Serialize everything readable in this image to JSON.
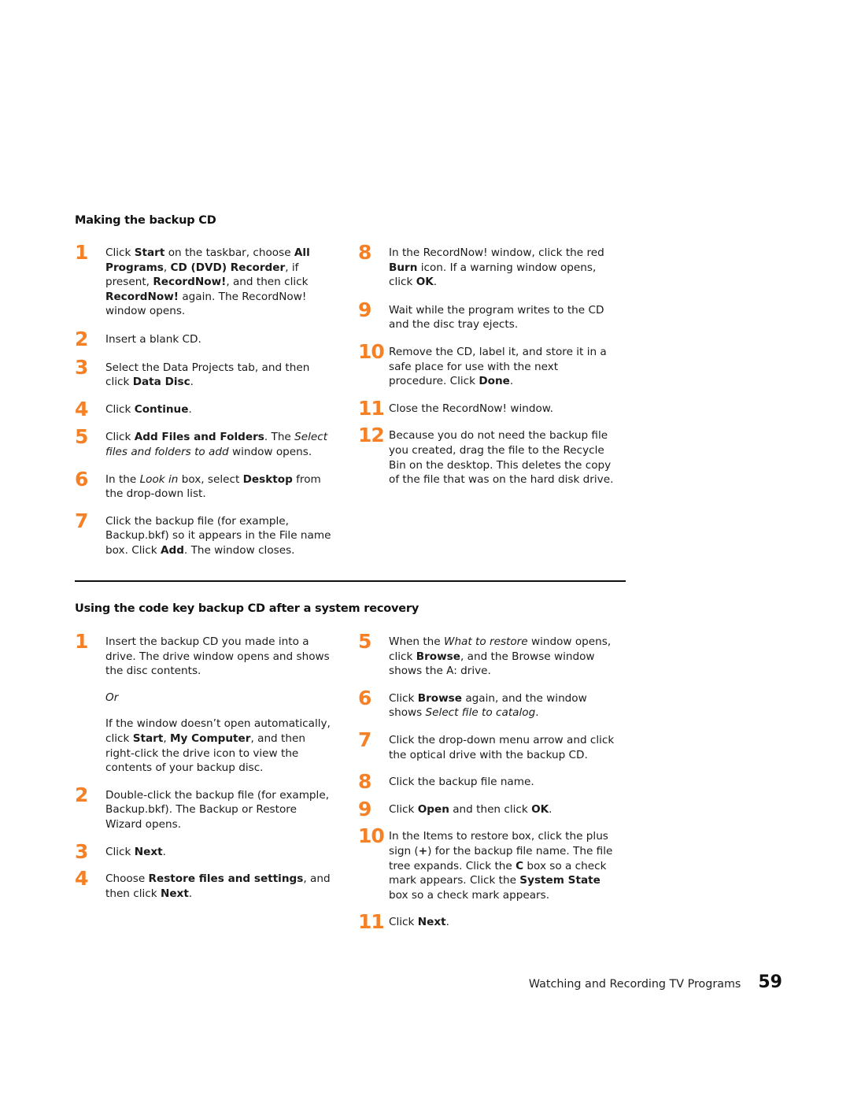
{
  "section1": {
    "title": "Making the backup CD",
    "left_steps": [
      {
        "num": "1",
        "parts": [
          {
            "t": "Click "
          },
          {
            "t": "Start",
            "b": true
          },
          {
            "t": " on the taskbar, choose "
          },
          {
            "t": "All Programs",
            "b": true
          },
          {
            "t": ", "
          },
          {
            "t": "CD (DVD) Recorder",
            "b": true
          },
          {
            "t": ", if present, "
          },
          {
            "t": "RecordNow!",
            "b": true
          },
          {
            "t": ", and then click "
          },
          {
            "t": "RecordNow!",
            "b": true
          },
          {
            "t": " again. The RecordNow! window opens."
          }
        ]
      },
      {
        "num": "2",
        "parts": [
          {
            "t": "Insert a blank CD."
          }
        ]
      },
      {
        "num": "3",
        "parts": [
          {
            "t": "Select the Data Projects tab, and then click "
          },
          {
            "t": "Data Disc",
            "b": true
          },
          {
            "t": "."
          }
        ]
      },
      {
        "num": "4",
        "parts": [
          {
            "t": "Click "
          },
          {
            "t": "Continue",
            "b": true
          },
          {
            "t": "."
          }
        ]
      },
      {
        "num": "5",
        "parts": [
          {
            "t": "Click "
          },
          {
            "t": "Add Files and Folders",
            "b": true
          },
          {
            "t": ". The "
          },
          {
            "t": "Select files and folders to add",
            "i": true
          },
          {
            "t": " window opens."
          }
        ]
      },
      {
        "num": "6",
        "parts": [
          {
            "t": "In the "
          },
          {
            "t": "Look in",
            "i": true
          },
          {
            "t": " box, select "
          },
          {
            "t": "Desktop",
            "b": true
          },
          {
            "t": " from the drop-down list."
          }
        ]
      },
      {
        "num": "7",
        "parts": [
          {
            "t": "Click the backup file (for example, Backup.bkf) so it appears in the File name box. Click "
          },
          {
            "t": "Add",
            "b": true
          },
          {
            "t": ". The window closes."
          }
        ]
      }
    ],
    "right_steps": [
      {
        "num": "8",
        "parts": [
          {
            "t": "In the RecordNow! window, click the red "
          },
          {
            "t": "Burn",
            "b": true
          },
          {
            "t": " icon. If a warning window opens, click "
          },
          {
            "t": "OK",
            "b": true
          },
          {
            "t": "."
          }
        ]
      },
      {
        "num": "9",
        "parts": [
          {
            "t": "Wait while the program writes to the CD and the disc tray ejects."
          }
        ]
      },
      {
        "num": "10",
        "parts": [
          {
            "t": "Remove the CD, label it, and store it in a safe place for use with the next procedure. Click "
          },
          {
            "t": "Done",
            "b": true
          },
          {
            "t": "."
          }
        ]
      },
      {
        "num": "11",
        "parts": [
          {
            "t": "Close the RecordNow! window."
          }
        ]
      },
      {
        "num": "12",
        "parts": [
          {
            "t": "Because you do not need the backup file you created, drag the file to the Recycle Bin on the desktop. This deletes the copy of the file that was on the hard disk drive."
          }
        ]
      }
    ]
  },
  "section2": {
    "title": "Using the code key backup CD after a system recovery",
    "left_steps": [
      {
        "num": "1",
        "paras": [
          [
            {
              "t": "Insert the backup CD you made into a drive. The drive window opens and shows the disc contents."
            }
          ],
          [
            {
              "t": "Or",
              "i": true
            }
          ],
          [
            {
              "t": "If the window doesn’t open automatically, click "
            },
            {
              "t": "Start",
              "b": true
            },
            {
              "t": ", "
            },
            {
              "t": "My Computer",
              "b": true
            },
            {
              "t": ", and then right-click the drive icon to view the contents of your backup disc."
            }
          ]
        ]
      },
      {
        "num": "2",
        "parts": [
          {
            "t": "Double-click the backup file (for example, Backup.bkf). The Backup or Restore Wizard opens."
          }
        ]
      },
      {
        "num": "3",
        "parts": [
          {
            "t": "Click "
          },
          {
            "t": "Next",
            "b": true
          },
          {
            "t": "."
          }
        ]
      },
      {
        "num": "4",
        "parts": [
          {
            "t": "Choose "
          },
          {
            "t": "Restore files and settings",
            "b": true
          },
          {
            "t": ", and then click "
          },
          {
            "t": "Next",
            "b": true
          },
          {
            "t": "."
          }
        ]
      }
    ],
    "right_steps": [
      {
        "num": "5",
        "parts": [
          {
            "t": "When the "
          },
          {
            "t": "What to restore",
            "i": true
          },
          {
            "t": " window opens, click "
          },
          {
            "t": "Browse",
            "b": true
          },
          {
            "t": ", and the Browse window shows the A: drive."
          }
        ]
      },
      {
        "num": "6",
        "parts": [
          {
            "t": "Click "
          },
          {
            "t": "Browse",
            "b": true
          },
          {
            "t": " again, and the window shows "
          },
          {
            "t": "Select file to catalog",
            "i": true
          },
          {
            "t": "."
          }
        ]
      },
      {
        "num": "7",
        "parts": [
          {
            "t": "Click the drop-down menu arrow and click the optical drive with the backup CD."
          }
        ]
      },
      {
        "num": "8",
        "parts": [
          {
            "t": "Click the backup file name."
          }
        ]
      },
      {
        "num": "9",
        "parts": [
          {
            "t": "Click "
          },
          {
            "t": "Open",
            "b": true
          },
          {
            "t": " and then click "
          },
          {
            "t": "OK",
            "b": true
          },
          {
            "t": "."
          }
        ]
      },
      {
        "num": "10",
        "parts": [
          {
            "t": "In the Items to restore box, click the plus sign ("
          },
          {
            "t": "+",
            "b": true
          },
          {
            "t": ") for the backup file name. The file tree expands. Click the "
          },
          {
            "t": "C",
            "b": true
          },
          {
            "t": " box so a check mark appears. Click the "
          },
          {
            "t": "System State",
            "b": true
          },
          {
            "t": " box so a check mark appears."
          }
        ]
      },
      {
        "num": "11",
        "parts": [
          {
            "t": "Click "
          },
          {
            "t": "Next",
            "b": true
          },
          {
            "t": "."
          }
        ]
      }
    ]
  },
  "footer": {
    "chapter_title": "Watching and Recording TV Programs",
    "page_number": "59"
  },
  "colors": {
    "step_number": "#F58025",
    "text": "#1a1a1a"
  }
}
